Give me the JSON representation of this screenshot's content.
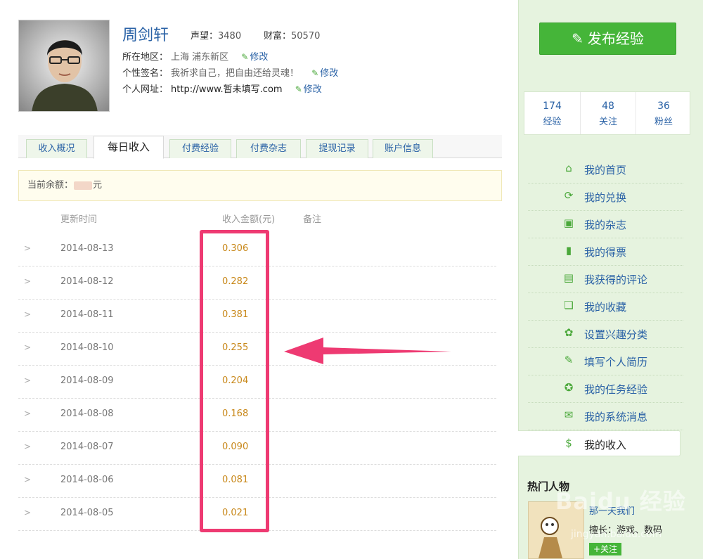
{
  "profile": {
    "name": "周剑轩",
    "reputation_label": "声望：",
    "reputation_value": "3480",
    "wealth_label": "财富：",
    "wealth_value": "50570",
    "location_label": "所在地区：",
    "location_value": "上海 浦东新区",
    "signature_label": "个性签名：",
    "signature_value": "我祈求自己，把自由还给灵魂！",
    "website_label": "个人网址：",
    "website_value": "http://www.暂未填写.com",
    "edit_label": "修改"
  },
  "tabs": [
    "收入概况",
    "每日收入",
    "付费经验",
    "付费杂志",
    "提现记录",
    "账户信息"
  ],
  "balance": {
    "label": "当前余额：",
    "unit": "元"
  },
  "table": {
    "headers": {
      "time": "更新时间",
      "amount": "收入金额(元)",
      "note": "备注"
    },
    "rows": [
      {
        "date": "2014-08-13",
        "amount": "0.306"
      },
      {
        "date": "2014-08-12",
        "amount": "0.282"
      },
      {
        "date": "2014-08-11",
        "amount": "0.381"
      },
      {
        "date": "2014-08-10",
        "amount": "0.255"
      },
      {
        "date": "2014-08-09",
        "amount": "0.204"
      },
      {
        "date": "2014-08-08",
        "amount": "0.168"
      },
      {
        "date": "2014-08-07",
        "amount": "0.090"
      },
      {
        "date": "2014-08-06",
        "amount": "0.081"
      },
      {
        "date": "2014-08-05",
        "amount": "0.021"
      }
    ],
    "row_marker": ">"
  },
  "sidebar": {
    "publish_label": "发布经验",
    "counts": [
      {
        "num": "174",
        "label": "经验"
      },
      {
        "num": "48",
        "label": "关注"
      },
      {
        "num": "36",
        "label": "粉丝"
      }
    ],
    "menu": [
      {
        "label": "我的首页",
        "icon": "home-icon",
        "glyph": "⌂"
      },
      {
        "label": "我的兑换",
        "icon": "exchange-icon",
        "glyph": "⟳"
      },
      {
        "label": "我的杂志",
        "icon": "magazine-icon",
        "glyph": "▣"
      },
      {
        "label": "我的得票",
        "icon": "bar-chart-icon",
        "glyph": "▮"
      },
      {
        "label": "我获得的评论",
        "icon": "comment-icon",
        "glyph": "▤"
      },
      {
        "label": "我的收藏",
        "icon": "collection-icon",
        "glyph": "❏"
      },
      {
        "label": "设置兴趣分类",
        "icon": "gear-icon",
        "glyph": "✿"
      },
      {
        "label": "填写个人简历",
        "icon": "resume-icon",
        "glyph": "✎"
      },
      {
        "label": "我的任务经验",
        "icon": "task-icon",
        "glyph": "✪"
      },
      {
        "label": "我的系统消息",
        "icon": "mail-icon",
        "glyph": "✉"
      },
      {
        "label": "我的收入",
        "icon": "dollar-icon",
        "glyph": "$"
      }
    ],
    "hot_title": "热门人物",
    "hot_person": {
      "name": "那一天我们",
      "skill": "擅长：游戏、数码",
      "follow": "+关注"
    },
    "watermark": "Baidu 经验",
    "watermark_url": "jingyan.baidu.com"
  },
  "colors": {
    "accent_green": "#45b539",
    "link_blue": "#2a62a6",
    "highlight_pink": "#ee3a72",
    "amount_orange": "#c8881a"
  }
}
